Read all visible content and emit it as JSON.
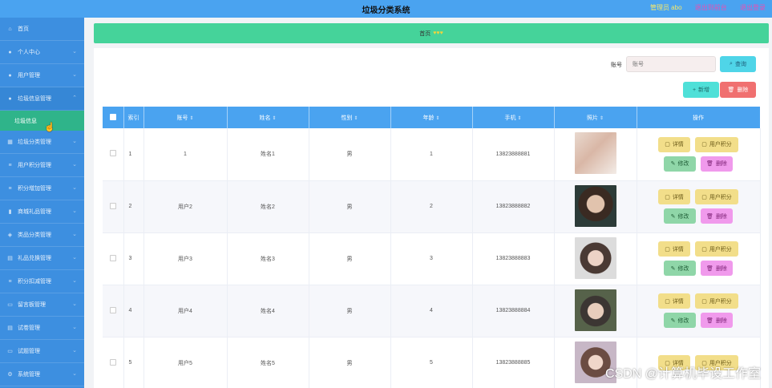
{
  "header": {
    "title": "垃圾分类系统",
    "admin_label": "管理员 abo",
    "link_front": "退出到前台",
    "link_logout": "退出登录"
  },
  "sidebar": {
    "items": [
      {
        "label": "首页",
        "icon": "home-icon"
      },
      {
        "label": "个人中心",
        "icon": "user-icon"
      },
      {
        "label": "用户管理",
        "icon": "users-icon"
      },
      {
        "label": "垃圾信息管理",
        "icon": "user-icon"
      },
      {
        "label": "垃圾分类管理",
        "icon": "grid-icon"
      },
      {
        "label": "用户积分管理",
        "icon": "list-icon"
      },
      {
        "label": "积分增加管理",
        "icon": "list-icon"
      },
      {
        "label": "商城礼品管理",
        "icon": "chart-icon"
      },
      {
        "label": "类品分类管理",
        "icon": "gift-icon"
      },
      {
        "label": "礼品兑换管理",
        "icon": "cart-icon"
      },
      {
        "label": "积分扣减管理",
        "icon": "list-icon"
      },
      {
        "label": "留言板管理",
        "icon": "message-icon"
      },
      {
        "label": "试卷管理",
        "icon": "paper-icon"
      },
      {
        "label": "试题管理",
        "icon": "question-icon"
      },
      {
        "label": "系统管理",
        "icon": "gear-icon"
      }
    ],
    "active_sub": "垃圾信息"
  },
  "banner": {
    "text": "首页",
    "hearts": "♥♥♥"
  },
  "search": {
    "label": "账号",
    "placeholder": "账号",
    "button": "查询"
  },
  "toolbar": {
    "add": "新增",
    "delete": "删除"
  },
  "table": {
    "headers": [
      "索引",
      "账号",
      "姓名",
      "性别",
      "年龄",
      "手机",
      "照片",
      "操作"
    ],
    "rows": [
      {
        "index": "1",
        "account": "1",
        "name": "姓名1",
        "gender": "男",
        "age": "1",
        "phone": "13823888881"
      },
      {
        "index": "2",
        "account": "用户2",
        "name": "姓名2",
        "gender": "男",
        "age": "2",
        "phone": "13823888882"
      },
      {
        "index": "3",
        "account": "用户3",
        "name": "姓名3",
        "gender": "男",
        "age": "3",
        "phone": "13823888883"
      },
      {
        "index": "4",
        "account": "用户4",
        "name": "姓名4",
        "gender": "男",
        "age": "4",
        "phone": "13823888884"
      },
      {
        "index": "5",
        "account": "用户5",
        "name": "姓名5",
        "gender": "男",
        "age": "5",
        "phone": "13823888885"
      }
    ],
    "actions": {
      "detail": "详情",
      "points": "用户积分",
      "edit": "修改",
      "remove": "删除"
    }
  },
  "watermark": "CSDN @计算机毕设工作室",
  "colors": {
    "header": "#4aa3f0",
    "sidebar": "#3d8fe0",
    "sidebar_active": "#2fb48a",
    "banner": "#45d39a"
  }
}
